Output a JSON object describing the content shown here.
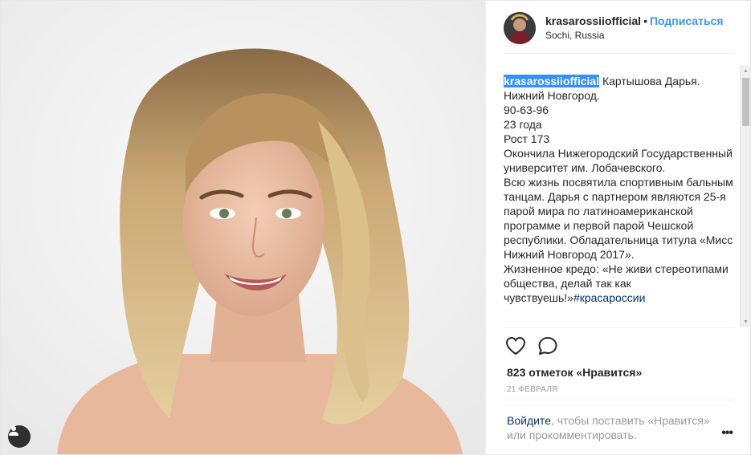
{
  "post": {
    "username": "krasarossiiofficial",
    "separator": "•",
    "follow_label": "Подписаться",
    "location": "Sochi, Russia",
    "caption": {
      "username": "krasarossiiofficial",
      "text": " Картышова Дарья. Нижний Новгород.\n90-63-96\n23 года\nРост 173\nОкончила Нижегородский Государственный университет им. Лобачевского.\nВсю жизнь посвятила спортивным бальным танцам. Дарья с партнером являются 25-я парой мира по латиноамериканской программе и первой парой Чешской республики. Обладательница титула «Мисс Нижний Новгород 2017».\nЖизненное кредо: «Не живи стереотипами общества, делай так как чувствуешь!»",
      "hashtag": "#красароссии"
    },
    "likes": "823 отметок «Нравится»",
    "date": "21 ФЕВРАЛЯ",
    "login_link": "Войдите",
    "login_text": ", чтобы поставить «Нравится» или прокомментировать.",
    "more_label": "•••"
  },
  "icons": {
    "like": "heart-outline-icon",
    "comment": "speech-bubble-icon",
    "tagged": "person-tag-icon"
  },
  "colors": {
    "accent": "#3897f0",
    "link": "#003569",
    "selection": "#3390ff"
  }
}
